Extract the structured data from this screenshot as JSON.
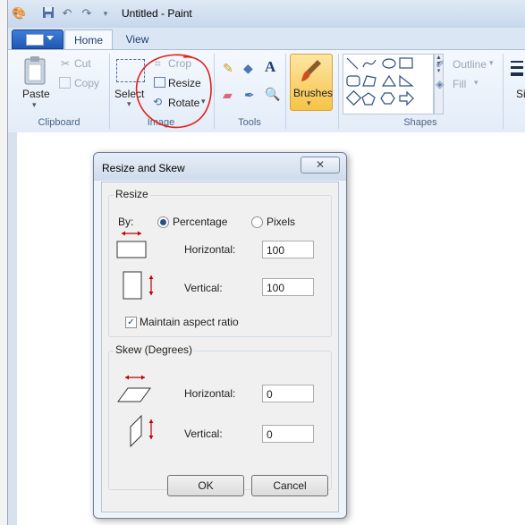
{
  "window": {
    "title": "Untitled - Paint"
  },
  "tabs": [
    {
      "label": "Home"
    },
    {
      "label": "View"
    }
  ],
  "ribbon": {
    "clipboard": {
      "group_label": "Clipboard",
      "paste": "Paste",
      "cut": "Cut",
      "copy": "Copy"
    },
    "image": {
      "group_label": "Image",
      "select": "Select",
      "crop": "Crop",
      "resize": "Resize",
      "rotate": "Rotate"
    },
    "tools": {
      "group_label": "Tools"
    },
    "brushes": {
      "label": "Brushes"
    },
    "shapes": {
      "group_label": "Shapes",
      "outline": "Outline",
      "fill": "Fill"
    },
    "size": {
      "label": "Si"
    }
  },
  "dialog": {
    "title": "Resize and Skew",
    "close_glyph": "✕",
    "resize": {
      "legend": "Resize",
      "by_label": "By:",
      "percentage_label": "Percentage",
      "pixels_label": "Pixels",
      "selected_unit": "Percentage",
      "horizontal_label": "Horizontal:",
      "horizontal_value": "100",
      "vertical_label": "Vertical:",
      "vertical_value": "100",
      "maintain_aspect_label": "Maintain aspect ratio",
      "maintain_aspect_checked": true
    },
    "skew": {
      "legend": "Skew (Degrees)",
      "horizontal_label": "Horizontal:",
      "horizontal_value": "0",
      "vertical_label": "Vertical:",
      "vertical_value": "0"
    },
    "ok_label": "OK",
    "cancel_label": "Cancel"
  },
  "colors": {
    "annotation_red": "#e0201b",
    "brushes_highlight": "#f6c347",
    "dialog_arrow_red": "#c00000"
  }
}
